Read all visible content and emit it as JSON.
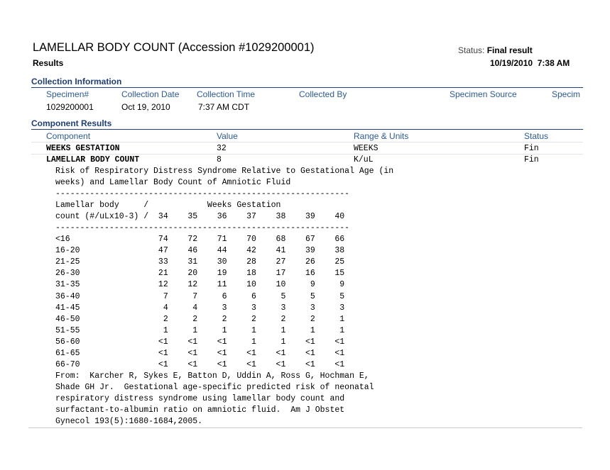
{
  "header": {
    "title": "LAMELLAR BODY COUNT (Accession #1029200001)",
    "subtitle": "Results",
    "status_label": "Status:",
    "status_value": "Final result",
    "datetime": "10/19/2010  7:38 AM"
  },
  "collection": {
    "section_title": "Collection Information",
    "columns": [
      "Specimen#",
      "Collection Date",
      "Collection Time",
      "Collected By",
      "Specimen Source",
      "Specim"
    ],
    "row": [
      "1029200001",
      "Oct 19, 2010",
      "7:37 AM CDT",
      "",
      "",
      ""
    ]
  },
  "components": {
    "section_title": "Component Results",
    "columns": [
      "Component",
      "Value",
      "Range & Units",
      "Status"
    ],
    "rows": [
      {
        "component": "WEEKS GESTATION",
        "value": "32",
        "range_units": "WEEKS",
        "status": "Fin"
      },
      {
        "component": "LAMELLAR BODY COUNT",
        "value": "8",
        "range_units": "K/uL",
        "status": "Fin"
      }
    ]
  },
  "comment_lines": [
    "Risk of Respiratory Distress Syndrome Relative to Gestational Age (in",
    "weeks) and Lamellar Body Count of Amniotic Fluid",
    "------------------------------------------------------------",
    "Lamellar body     /            Weeks Gestation",
    "count (#/uLx10-3) /  34    35    36    37    38    39    40",
    "------------------------------------------------------------",
    "<16                  74    72    71    70    68    67    66",
    "16-20                47    46    44    42    41    39    38",
    "21-25                33    31    30    28    27    26    25",
    "26-30                21    20    19    18    17    16    15",
    "31-35                12    12    11    10    10     9     9",
    "36-40                 7     7     6     6     5     5     5",
    "41-45                 4     4     3     3     3     3     3",
    "46-50                 2     2     2     2     2     2     1",
    "51-55                 1     1     1     1     1     1     1",
    "56-60                <1    <1    <1     1     1    <1    <1",
    "61-65                <1    <1    <1    <1    <1    <1    <1",
    "66-70                <1    <1    <1    <1    <1    <1    <1",
    "From:  Karcher R, Sykes E, Batton D, Uddin A, Ross G, Hochman E,",
    "Shade GH Jr.  Gestational age-specific predicted risk of neonatal",
    "respiratory distress syndrome using lamellar body count and",
    "surfactant-to-albumin ratio on amniotic fluid.  Am J Obstet",
    "Gynecol 193(5):1680-1684,2005."
  ]
}
